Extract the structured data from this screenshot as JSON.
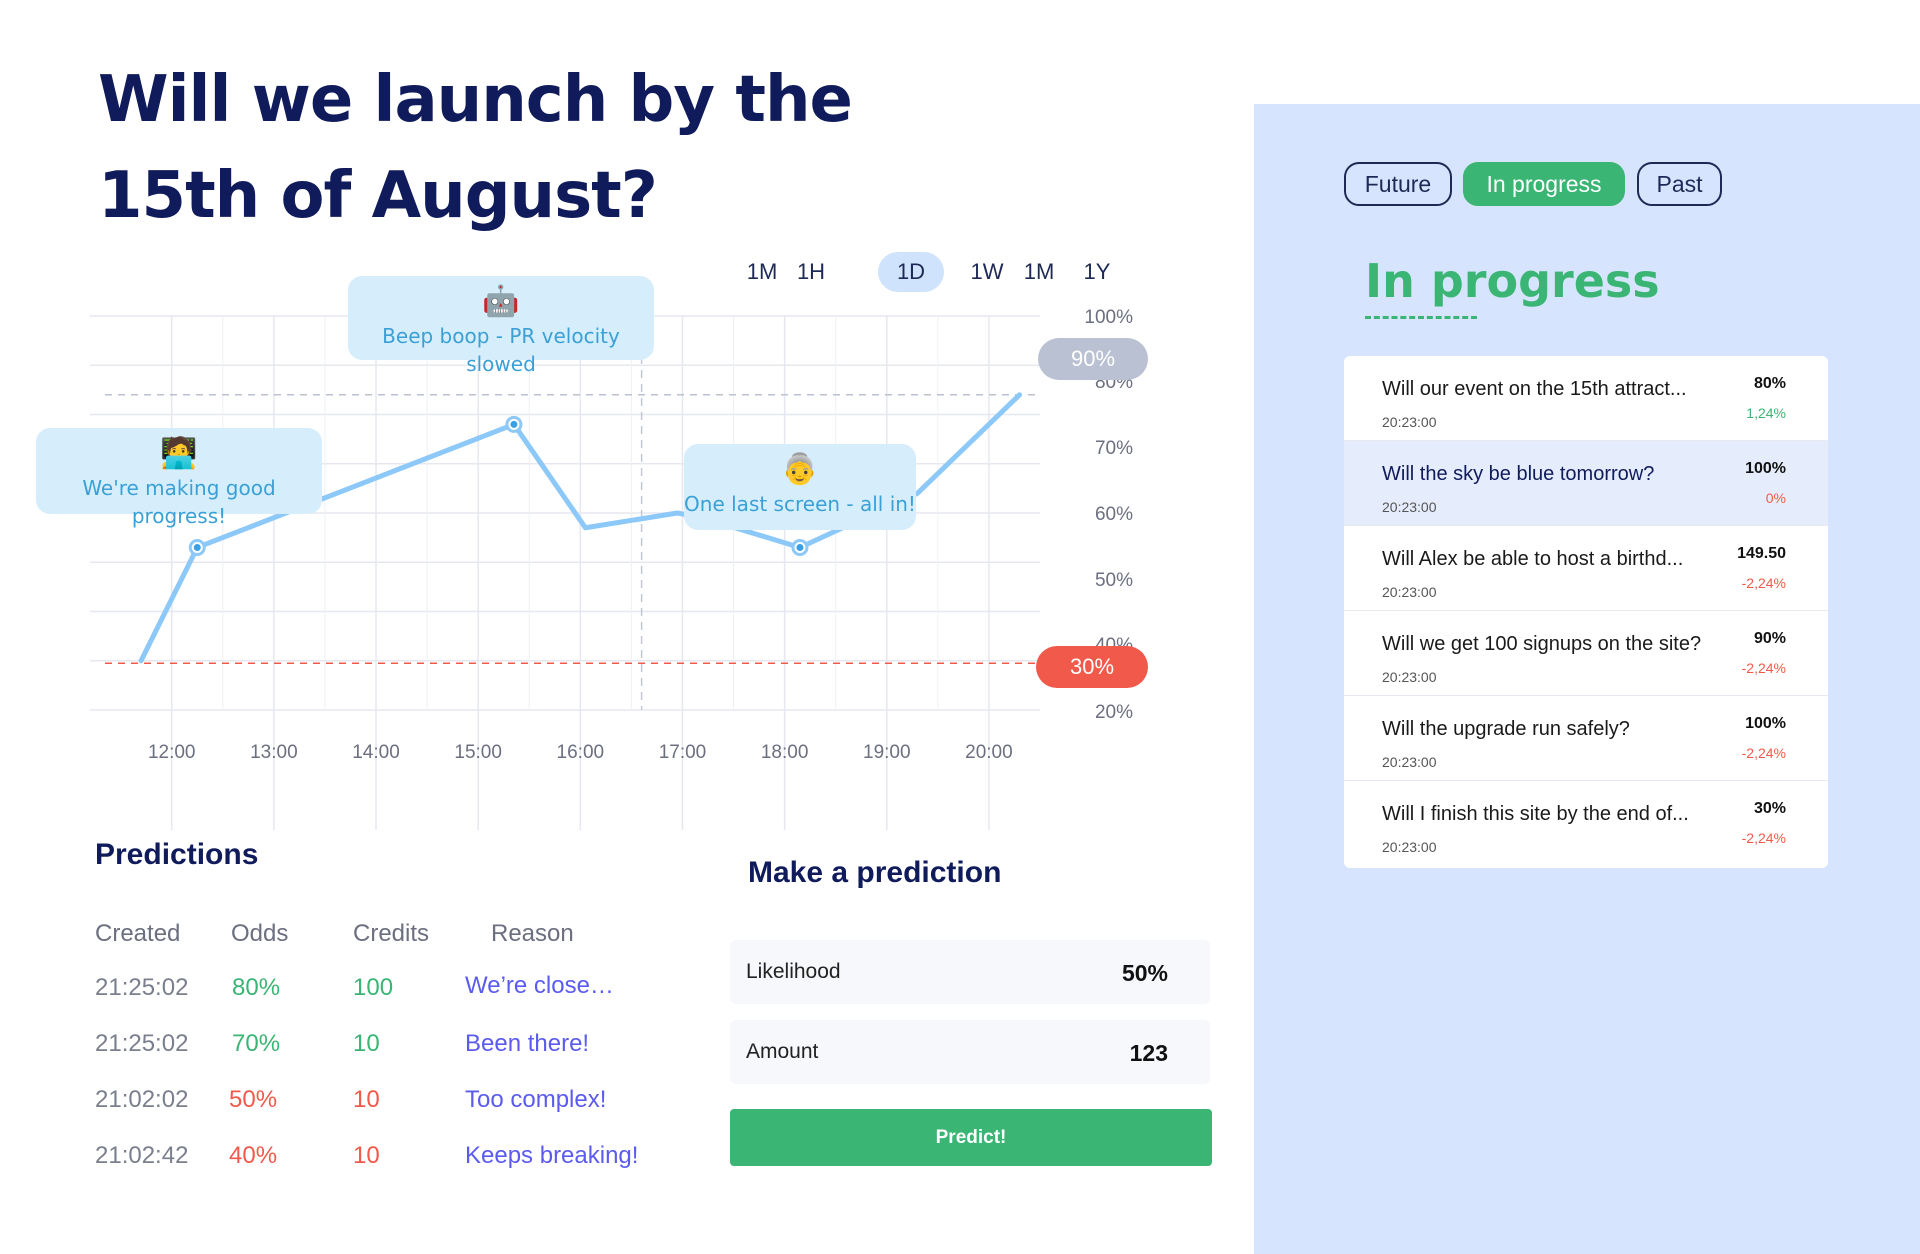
{
  "title": "Will we launch by the 15th of August?",
  "timeframes": [
    "1M",
    "1H",
    "1D",
    "1W",
    "1M",
    "1Y"
  ],
  "active_timeframe": "1D",
  "chart_data": {
    "type": "line",
    "x_labels": [
      "12:00",
      "13:00",
      "14:00",
      "15:00",
      "16:00",
      "17:00",
      "18:00",
      "19:00",
      "20:00"
    ],
    "y_ticks": [
      "100%",
      "80%",
      "70%",
      "60%",
      "50%",
      "40%",
      "20%"
    ],
    "ylim": [
      20,
      100
    ],
    "series": [
      {
        "x": [
          11.7,
          12.25,
          15.35,
          16.05,
          16.95,
          17.2,
          18.15,
          19.3,
          20.3
        ],
        "y": [
          30,
          53,
          78,
          57,
          60,
          59,
          53,
          64,
          84
        ],
        "color": "#8cc8f8"
      }
    ],
    "reference_lines": [
      {
        "label": "90%",
        "value": 84,
        "color": "#b9c1d3"
      },
      {
        "label": "30%",
        "value": 29.5,
        "color": "#f15a4a"
      }
    ],
    "annotations": [
      {
        "emoji": "🧑‍💻",
        "text": "We're making good progress!",
        "x": 12.25,
        "y": 53
      },
      {
        "emoji": "🤖",
        "text": "Beep boop - PR velocity slowed",
        "x": 15.35,
        "y": 78
      },
      {
        "emoji": "👵",
        "text": "One last screen - all in!",
        "x": 18.15,
        "y": 53
      }
    ],
    "now_marker_x": 16.6,
    "grid": true
  },
  "predictions": {
    "title": "Predictions",
    "headers": [
      "Created",
      "Odds",
      "Credits",
      "Reason"
    ],
    "rows": [
      {
        "created": "21:25:02",
        "odds": "80%",
        "credits": "100",
        "reason": "We’re close…",
        "tone": "green"
      },
      {
        "created": "21:25:02",
        "odds": "70%",
        "credits": "10",
        "reason": "Been there!",
        "tone": "green"
      },
      {
        "created": "21:02:02",
        "odds": "50%",
        "credits": "10",
        "reason": "Too complex!",
        "tone": "red"
      },
      {
        "created": "21:02:42",
        "odds": "40%",
        "credits": "10",
        "reason": "Keeps breaking!",
        "tone": "red"
      }
    ]
  },
  "make_prediction": {
    "title": "Make a prediction",
    "likelihood_label": "Likelihood",
    "likelihood_value": "50%",
    "amount_label": "Amount",
    "amount_value": "123",
    "button": "Predict!"
  },
  "sidebar": {
    "filters": [
      "Future",
      "In progress",
      "Past"
    ],
    "active_filter": "In progress",
    "title": "In progress",
    "markets": [
      {
        "question": "Will our event on the 15th attract...",
        "time": "20:23:00",
        "price": "80%",
        "change": "1,24%",
        "direction": "up"
      },
      {
        "question": "Will the sky be blue tomorrow?",
        "time": "20:23:00",
        "price": "100%",
        "change": "0%",
        "direction": "down",
        "highlighted": true
      },
      {
        "question": "Will Alex be able to host a birthd...",
        "time": "20:23:00",
        "price": "149.50",
        "change": "-2,24%",
        "direction": "down"
      },
      {
        "question": "Will we get 100 signups on the site?",
        "time": "20:23:00",
        "price": "90%",
        "change": "-2,24%",
        "direction": "down"
      },
      {
        "question": "Will the upgrade run safely?",
        "time": "20:23:00",
        "price": "100%",
        "change": "-2,24%",
        "direction": "down"
      },
      {
        "question": "Will I finish this site by the end of...",
        "time": "20:23:00",
        "price": "30%",
        "change": "-2,24%",
        "direction": "down"
      }
    ]
  },
  "colors": {
    "navy": "#101b5b",
    "green": "#3ab574",
    "red": "#f15a4a",
    "blue_line": "#8cc8f8",
    "reason": "#5b5bf0",
    "panel": "#d6e4fd"
  }
}
